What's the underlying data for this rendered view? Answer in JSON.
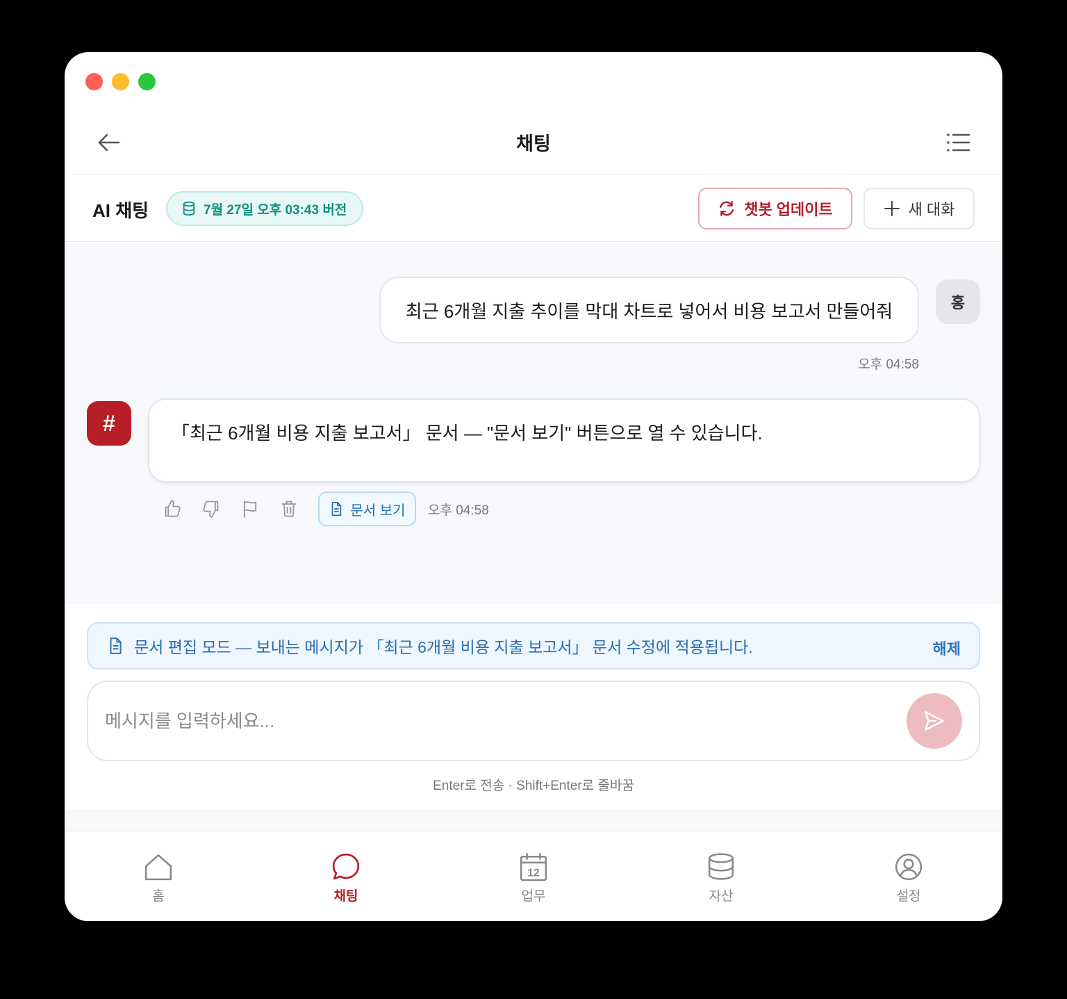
{
  "topbar": {
    "title": "채팅"
  },
  "subheader": {
    "title": "AI 채팅",
    "version_badge": "7월 27일 오후 03:43 버전",
    "update_button": "챗봇 업데이트",
    "new_chat_button": "새 대화"
  },
  "messages": {
    "user": {
      "text": "최근 6개월 지출 추이를 막대 차트로 넣어서 비용 보고서 만들어줘",
      "avatar": "홍",
      "time": "오후 04:58"
    },
    "bot": {
      "avatar": "#",
      "text": "「최근 6개월 비용 지출 보고서」 문서 — \"문서 보기\" 버튼으로 열 수 있습니다.",
      "doc_button": "문서 보기",
      "time": "오후 04:58"
    }
  },
  "edit_banner": {
    "text": "문서 편집 모드 — 보내는 메시지가 「최근 6개월 비용 지출 보고서」 문서 수정에 적용됩니다.",
    "release": "해제"
  },
  "composer": {
    "placeholder": "메시지를 입력하세요...",
    "hint": "Enter로 전송 · Shift+Enter로 줄바꿈"
  },
  "tabs": [
    {
      "label": "홈",
      "icon": "home-icon"
    },
    {
      "label": "채팅",
      "icon": "chat-icon",
      "active": true
    },
    {
      "label": "업무",
      "icon": "calendar-icon",
      "calendar_day": "12"
    },
    {
      "label": "자산",
      "icon": "database-icon"
    },
    {
      "label": "설정",
      "icon": "user-circle-icon"
    }
  ],
  "colors": {
    "accent": "#b4202c",
    "send_button": "#eebcc0",
    "info_blue": "#2a6db1",
    "badge_teal": "#0f8f84",
    "traffic_red": "#ff5f57",
    "traffic_yellow": "#febc2e",
    "traffic_green": "#28c840"
  }
}
